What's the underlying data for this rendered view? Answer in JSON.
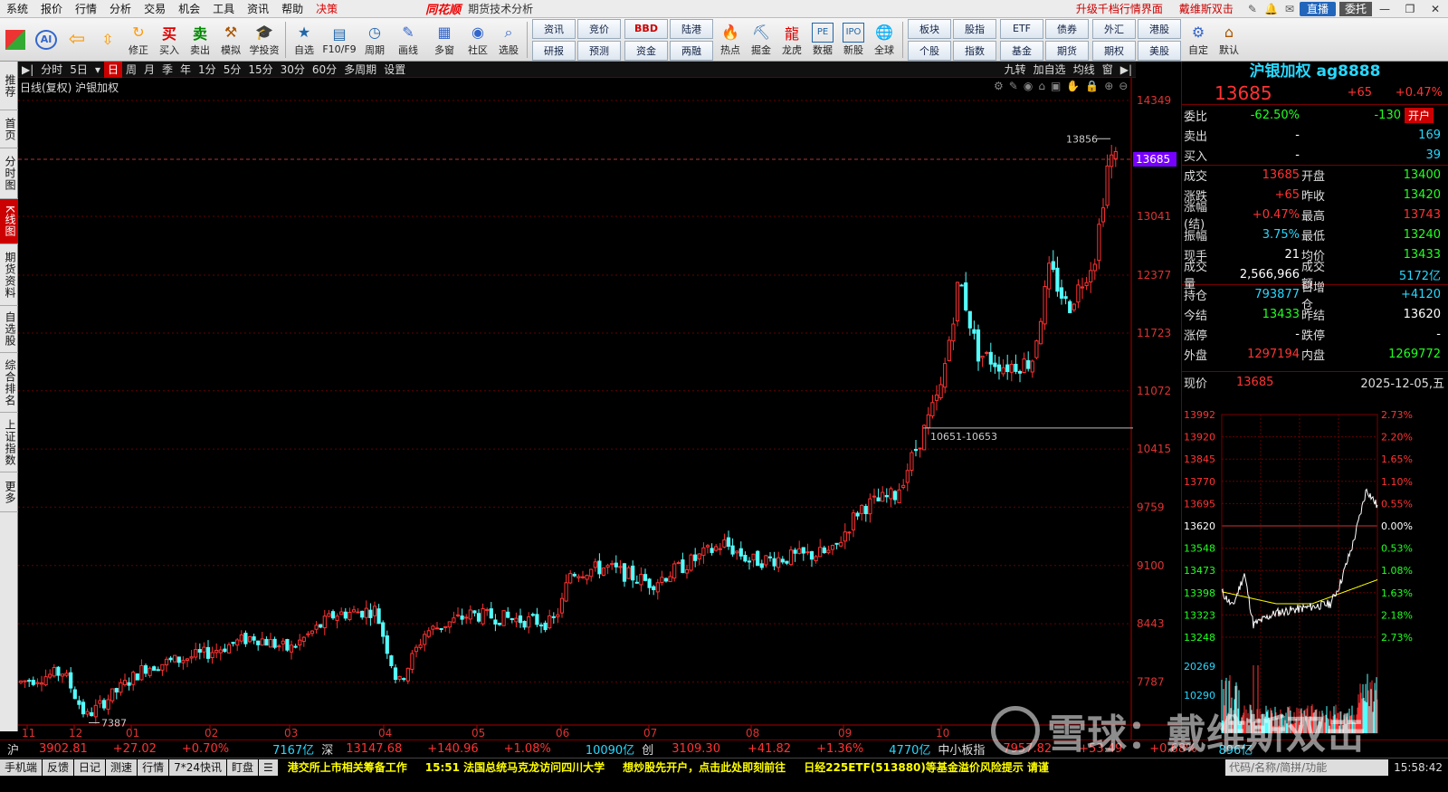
{
  "menu": {
    "items": [
      "系统",
      "报价",
      "行情",
      "分析",
      "交易",
      "机会",
      "工具",
      "资讯",
      "帮助",
      "决策"
    ],
    "brand": "同花顺",
    "window_title": "期货技术分析",
    "upgrade": "升级千档行情界面",
    "user": "戴维斯双击",
    "live": "直播",
    "entrust": "委托"
  },
  "toolbar": {
    "left_buttons": [
      "",
      "",
      "",
      "修正",
      "买入",
      "卖出",
      "模拟",
      "学投资",
      "自选",
      "F10/F9",
      "周期",
      "画线",
      "多窗",
      "社区",
      "选股"
    ],
    "grid1": [
      "资讯",
      "竞价",
      "研报",
      "预测"
    ],
    "grid2": [
      "BBD",
      "陆港",
      "资金",
      "两融"
    ],
    "mid_buttons": [
      "热点",
      "掘金",
      "龙虎",
      "数据",
      "新股",
      "全球"
    ],
    "grid3": [
      "板块",
      "股指",
      "个股",
      "指数"
    ],
    "grid4": [
      "ETF",
      "债券",
      "基金",
      "期货"
    ],
    "grid5": [
      "外汇",
      "港股",
      "期权",
      "美股"
    ],
    "right_buttons": [
      "自定",
      "默认"
    ]
  },
  "left_tabs": [
    "推荐",
    "首页",
    "分时图",
    "K线图",
    "期货资料",
    "自选股",
    "综合排名",
    "上证指数",
    "更多"
  ],
  "chart_toolbar": {
    "periods": [
      "分时",
      "5日",
      "日",
      "周",
      "月",
      "季",
      "年",
      "1分",
      "5分",
      "15分",
      "30分",
      "60分",
      "多周期",
      "设置"
    ],
    "active": "日",
    "right": [
      "九转",
      "加自选",
      "均线",
      "窗"
    ]
  },
  "chart_caption": "日线(复权)  沪银加权",
  "chart_data": {
    "type": "candlestick",
    "price_axis_ticks": [
      14349,
      13685,
      13041,
      12377,
      11723,
      11072,
      10415,
      9759,
      9100,
      8443,
      7787
    ],
    "x_labels": [
      "11",
      "12",
      "01",
      "02",
      "03",
      "04",
      "05",
      "06",
      "07",
      "08",
      "09",
      "10"
    ],
    "annotations": {
      "high": "13856",
      "low": "7387",
      "gap": "10651-10653",
      "last_price": "13685"
    },
    "ylim": [
      7300,
      14400
    ]
  },
  "quote": {
    "title": "沪银加权 ag8888",
    "price": "13685",
    "change": "+65",
    "change_pct": "+0.47%",
    "rows": [
      {
        "l1": "委比",
        "v1": "-62.50%",
        "c1": "green",
        "l2": "",
        "v2": "-130",
        "c2": "green",
        "badge": "开户"
      },
      {
        "l1": "卖出",
        "v1": "-",
        "c1": "white",
        "l2": "",
        "v2": "169",
        "c2": "cyan"
      },
      {
        "l1": "买入",
        "v1": "-",
        "c1": "white",
        "l2": "",
        "v2": "39",
        "c2": "cyan"
      },
      {
        "l1": "成交",
        "v1": "13685",
        "c1": "red",
        "l2": "开盘",
        "v2": "13400",
        "c2": "green"
      },
      {
        "l1": "涨跌",
        "v1": "+65",
        "c1": "red",
        "l2": "昨收",
        "v2": "13420",
        "c2": "green"
      },
      {
        "l1": "涨幅(结)",
        "v1": "+0.47%",
        "c1": "red",
        "l2": "最高",
        "v2": "13743",
        "c2": "red"
      },
      {
        "l1": "振幅",
        "v1": "3.75%",
        "c1": "cyan",
        "l2": "最低",
        "v2": "13240",
        "c2": "green"
      },
      {
        "l1": "现手",
        "v1": "21",
        "c1": "white",
        "l2": "均价",
        "v2": "13433",
        "c2": "green"
      },
      {
        "l1": "成交量",
        "v1": "2,566,966",
        "c1": "white",
        "l2": "成交额",
        "v2": "5172亿",
        "c2": "cyan"
      },
      {
        "l1": "持仓",
        "v1": "793877",
        "c1": "cyan",
        "l2": "日增仓",
        "v2": "+4120",
        "c2": "cyan"
      },
      {
        "l1": "今结",
        "v1": "13433",
        "c1": "green",
        "l2": "昨结",
        "v2": "13620",
        "c2": "white"
      },
      {
        "l1": "涨停",
        "v1": "-",
        "c1": "white",
        "l2": "跌停",
        "v2": "-",
        "c2": "white"
      },
      {
        "l1": "外盘",
        "v1": "1297194",
        "c1": "red",
        "l2": "内盘",
        "v2": "1269772",
        "c2": "green"
      }
    ],
    "mini_label": "现价",
    "mini_price": "13685",
    "mini_date": "2025-12-05,五",
    "mini_ticks_left": [
      "13992",
      "13920",
      "13845",
      "13770",
      "13695",
      "13620",
      "13548",
      "13473",
      "13398",
      "13323",
      "13248"
    ],
    "mini_ticks_right": [
      "2.73%",
      "2.20%",
      "1.65%",
      "1.10%",
      "0.55%",
      "0.00%",
      "0.53%",
      "1.08%",
      "1.63%",
      "2.18%",
      "2.73%"
    ],
    "mini_vol_ticks": [
      "20269",
      "10290"
    ]
  },
  "index_bar": {
    "sh": "沪",
    "sh_val": "3902.81",
    "sh_chg": "+27.02",
    "sh_pct": "+0.70%",
    "sh_amt": "7167亿",
    "sz": "深",
    "sz_val": "13147.68",
    "sz_chg": "+140.96",
    "sz_pct": "+1.08%",
    "sz_amt": "10090亿",
    "cy": "创",
    "cy_val": "3109.30",
    "cy_chg": "+41.82",
    "cy_pct": "+1.36%",
    "cy_amt": "4770亿",
    "zz": "中小板指",
    "zz_val": "7957.82",
    "zz_chg": "+53.49",
    "zz_pct": "+0.68%",
    "zz_amt": "896亿"
  },
  "status_bar": {
    "buttons": [
      "手机端",
      "反馈",
      "日记",
      "测速",
      "行情",
      "7*24快讯",
      "盯盘"
    ],
    "news": [
      "港交所上市相关筹备工作",
      "15:51 法国总统马克龙访问四川大学",
      "想炒股先开户，点击此处即刻前往",
      "日经225ETF(513880)等基金溢价风险提示 请谨"
    ],
    "search_placeholder": "代码/名称/简拼/功能",
    "clock": "15:58:42"
  },
  "watermark": "雪球：戴维斯双击"
}
